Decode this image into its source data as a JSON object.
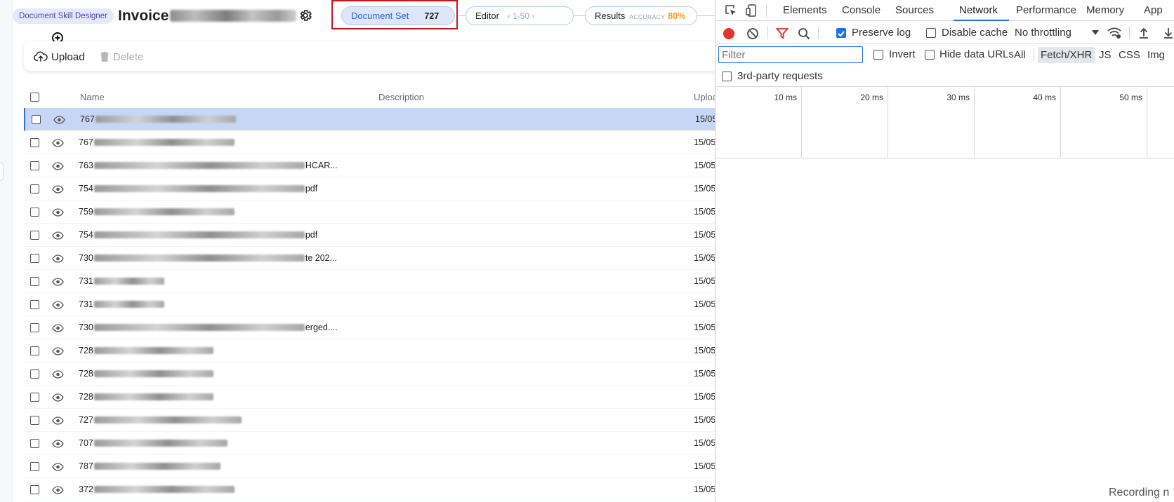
{
  "header": {
    "badge": "Document Skill Designer",
    "title_prefix": "Invoice",
    "steps": {
      "document_set": {
        "label": "Document Set",
        "count": "727"
      },
      "editor": {
        "label": "Editor",
        "range": "1-50"
      },
      "results": {
        "label": "Results",
        "accuracy_label": "ACCURACY",
        "accuracy_value": "80%",
        "accuracy_color": "#f39a1f"
      }
    }
  },
  "toolbar": {
    "upload_label": "Upload",
    "delete_label": "Delete"
  },
  "table": {
    "columns": {
      "name": "Name",
      "description": "Description",
      "upload": "Uploa"
    },
    "rows": [
      {
        "prefix": "767",
        "tail": "",
        "date": "15/05",
        "selected": true
      },
      {
        "prefix": "767",
        "tail": "",
        "date": "15/05",
        "selected": false
      },
      {
        "prefix": "763",
        "tail": "HCAR...",
        "date": "15/05",
        "selected": false
      },
      {
        "prefix": "754",
        "tail": "pdf",
        "date": "15/05",
        "selected": false
      },
      {
        "prefix": "759",
        "tail": "",
        "date": "15/05",
        "selected": false
      },
      {
        "prefix": "754",
        "tail": "pdf",
        "date": "15/05",
        "selected": false
      },
      {
        "prefix": "730",
        "tail": "te 202...",
        "date": "15/05",
        "selected": false
      },
      {
        "prefix": "731",
        "tail": "",
        "date": "15/05",
        "selected": false
      },
      {
        "prefix": "731",
        "tail": "",
        "date": "15/05",
        "selected": false
      },
      {
        "prefix": "730",
        "tail": "erged....",
        "date": "15/05",
        "selected": false
      },
      {
        "prefix": "728",
        "tail": "",
        "date": "15/05",
        "selected": false
      },
      {
        "prefix": "728",
        "tail": "",
        "date": "15/05",
        "selected": false
      },
      {
        "prefix": "728",
        "tail": "",
        "date": "15/05",
        "selected": false
      },
      {
        "prefix": "727",
        "tail": "",
        "date": "15/05",
        "selected": false
      },
      {
        "prefix": "707",
        "tail": "",
        "date": "15/05",
        "selected": false
      },
      {
        "prefix": "787",
        "tail": "",
        "date": "15/05",
        "selected": false
      },
      {
        "prefix": "372",
        "tail": "",
        "date": "15/05",
        "selected": false
      }
    ]
  },
  "devtools": {
    "tabs": [
      "Elements",
      "Console",
      "Sources",
      "Network",
      "Performance",
      "Memory",
      "App"
    ],
    "active_tab": "Network",
    "preserve_log": "Preserve log",
    "disable_cache": "Disable cache",
    "throttling": "No throttling",
    "filter_placeholder": "Filter",
    "invert": "Invert",
    "hide_data_urls": "Hide data URLs",
    "type_filters": [
      "All",
      "Fetch/XHR",
      "JS",
      "CSS",
      "Img"
    ],
    "active_type": "Fetch/XHR",
    "third_party": "3rd-party requests",
    "ticks": [
      "10 ms",
      "20 ms",
      "30 ms",
      "40 ms",
      "50 ms"
    ],
    "recording_text": "Recording n"
  }
}
